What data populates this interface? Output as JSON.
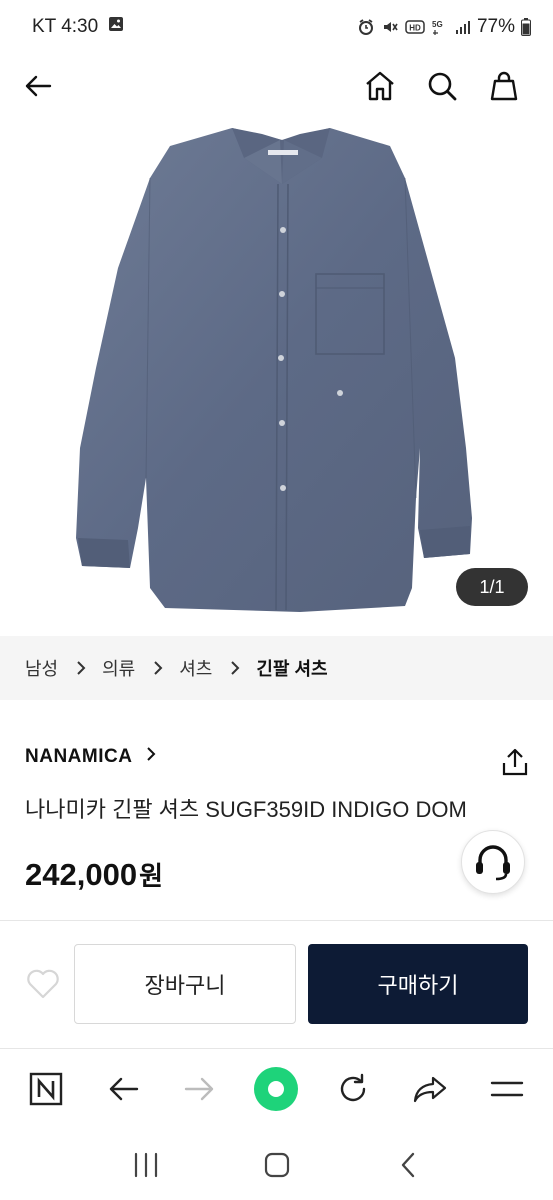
{
  "status_bar": {
    "carrier_time": "KT 4:30",
    "battery": "77%",
    "network": "5G"
  },
  "top_nav": {
    "icons": [
      "back-arrow-icon",
      "home-icon",
      "search-icon",
      "shopping-bag-icon"
    ]
  },
  "product_image": {
    "counter": "1/1"
  },
  "breadcrumb": {
    "items": [
      "남성",
      "의류",
      "셔츠",
      "긴팔 셔츠"
    ]
  },
  "product": {
    "brand": "NANAMICA",
    "title": "나나미카 긴팔 셔츠 SUGF359ID INDIGO DOM",
    "price_value": "242,000",
    "price_unit": "원"
  },
  "actions": {
    "cart_label": "장바구니",
    "buy_label": "구매하기"
  },
  "colors": {
    "accent_dark": "#0d1b35",
    "breadcrumb_bg": "#f5f5f5",
    "browser_green": "#1ed37a"
  }
}
